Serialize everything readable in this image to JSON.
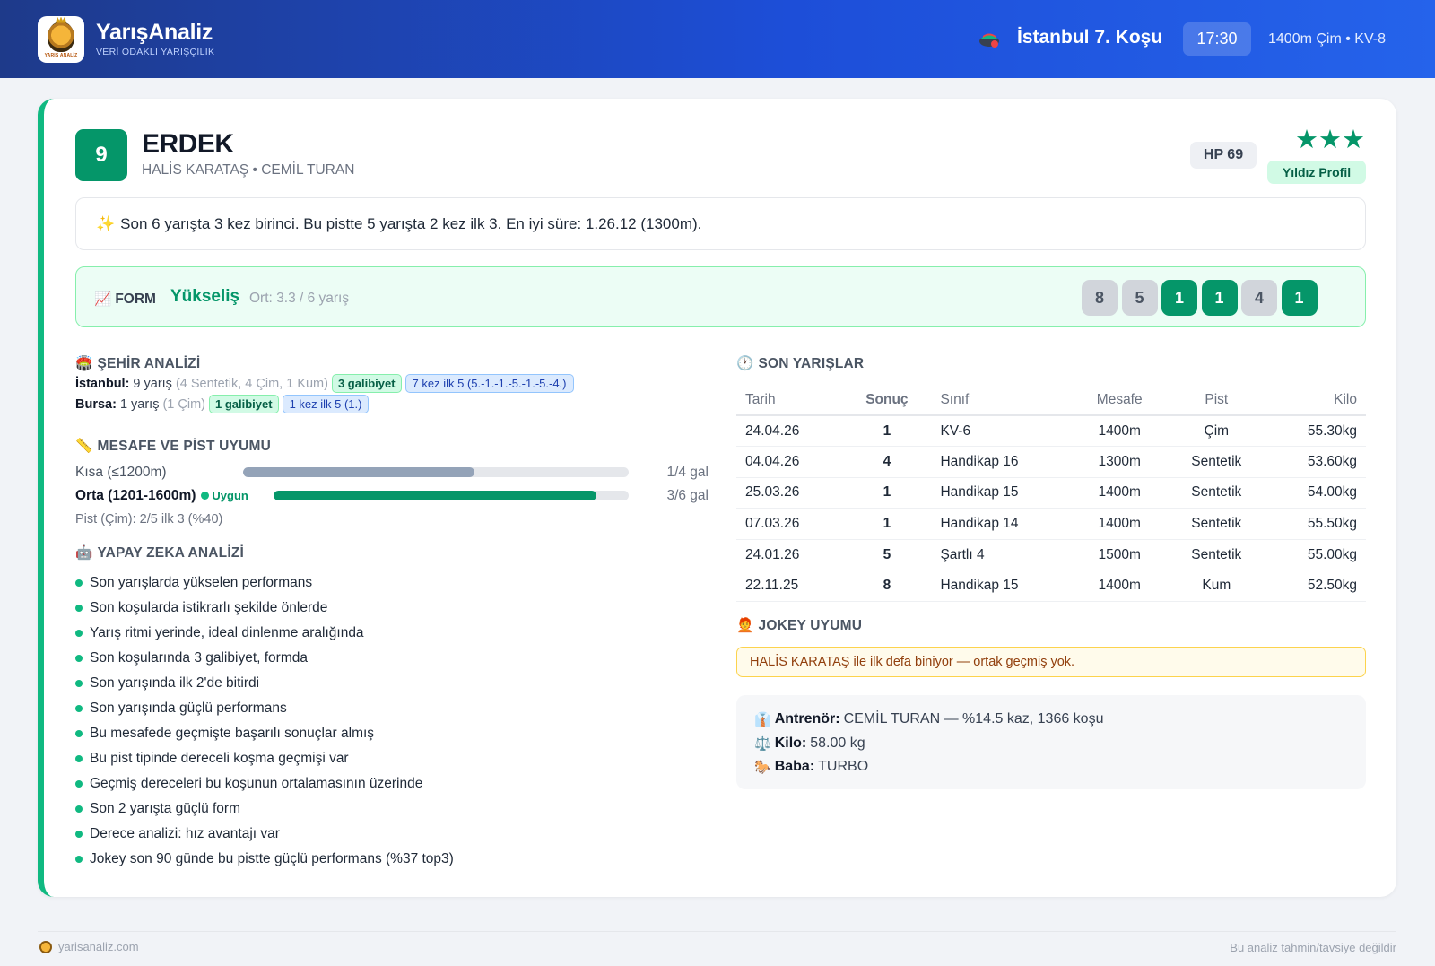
{
  "header": {
    "brand": "YarışAnaliz",
    "brand_sub": "VERİ ODAKLI YARIŞÇILIK",
    "logo_text": "YARIŞ ANALİZ",
    "race_title": "İstanbul 7. Koşu",
    "race_time": "17:30",
    "race_meta": "1400m Çim • KV-8"
  },
  "horse": {
    "number": "9",
    "name": "ERDEK",
    "connections": "HALİS KARATAŞ • CEMİL TURAN",
    "hp": "HP 69",
    "stars": "★★★",
    "star_count": 3,
    "profile": "Yıldız Profil"
  },
  "summary": "Son 6 yarışta 3 kez birinci. Bu pistte 5 yarışta 2 kez ilk 3. En iyi süre: 1.26.12 (1300m).",
  "form": {
    "label": "FORM",
    "trend": "Yükseliş",
    "avg": "Ort: 3.3 / 6 yarış",
    "results": [
      "8",
      "5",
      "1",
      "1",
      "4",
      "1"
    ]
  },
  "city": {
    "title": "ŞEHİR ANALİZİ",
    "rows": [
      {
        "city": "İstanbul:",
        "races": "9 yarış",
        "detail": "(4 Sentetik, 4 Çim, 1 Kum)",
        "wins": "3 galibiyet",
        "top5": "7 kez ilk 5 (5.-1.-1.-5.-1.-5.-4.)"
      },
      {
        "city": "Bursa:",
        "races": "1 yarış",
        "detail": "(1 Çim)",
        "wins": "1 galibiyet",
        "top5": "1 kez ilk 5 (1.)"
      }
    ]
  },
  "distance": {
    "title": "MESAFE VE PİST UYUMU",
    "rows": [
      {
        "label": "Kısa (≤1200m)",
        "count": "1/4 gal",
        "fill": 0.6,
        "color": "#94a3b8",
        "ok": ""
      },
      {
        "label": "Orta (1201-1600m)",
        "count": "3/6 gal",
        "fill": 0.91,
        "color": "#059669",
        "ok": "Uygun"
      }
    ],
    "pist_note": "Pist (Çim): 2/5 ilk 3 (%40)"
  },
  "ai": {
    "title": "YAPAY ZEKA ANALİZİ",
    "items": [
      "Son yarışlarda yükselen performans",
      "Son koşularda istikrarlı şekilde önlerde",
      "Yarış ritmi yerinde, ideal dinlenme aralığında",
      "Son koşularında 3 galibiyet, formda",
      "Son yarışında ilk 2'de bitirdi",
      "Son yarışında güçlü performans",
      "Bu mesafede geçmişte başarılı sonuçlar almış",
      "Bu pist tipinde dereceli koşma geçmişi var",
      "Geçmiş dereceleri bu koşunun ortalamasının üzerinde",
      "Son 2 yarışta güçlü form",
      "Derece analizi: hız avantajı var",
      "Jokey son 90 günde bu pistte güçlü performans (%37 top3)"
    ]
  },
  "recent": {
    "title": "SON YARIŞLAR",
    "columns": [
      "Tarih",
      "Sonuç",
      "Sınıf",
      "Mesafe",
      "Pist",
      "Kilo"
    ],
    "rows": [
      {
        "date": "24.04.26",
        "result": "1",
        "class": "KV-6",
        "distance": "1400m",
        "track": "Çim",
        "weight": "55.30kg"
      },
      {
        "date": "04.04.26",
        "result": "4",
        "class": "Handikap 16",
        "distance": "1300m",
        "track": "Sentetik",
        "weight": "53.60kg"
      },
      {
        "date": "25.03.26",
        "result": "1",
        "class": "Handikap 15",
        "distance": "1400m",
        "track": "Sentetik",
        "weight": "54.00kg"
      },
      {
        "date": "07.03.26",
        "result": "1",
        "class": "Handikap 14",
        "distance": "1400m",
        "track": "Sentetik",
        "weight": "55.50kg"
      },
      {
        "date": "24.01.26",
        "result": "5",
        "class": "Şartlı 4",
        "distance": "1500m",
        "track": "Sentetik",
        "weight": "55.00kg"
      },
      {
        "date": "22.11.25",
        "result": "8",
        "class": "Handikap 15",
        "distance": "1400m",
        "track": "Kum",
        "weight": "52.50kg"
      }
    ]
  },
  "jockey": {
    "title": "JOKEY UYUMU",
    "note": "HALİS KARATAŞ ile ilk defa biniyor — ortak geçmiş yok."
  },
  "info": {
    "trainer_label": "Antrenör:",
    "trainer_value": "CEMİL TURAN — %14.5 kaz, 1366 koşu",
    "weight_label": "Kilo:",
    "weight_value": "58.00 kg",
    "sire_label": "Baba:",
    "sire_value": "TURBO"
  },
  "footer": {
    "site": "yarisanaliz.com",
    "disclaimer": "Bu analiz tahmin/tavsiye değildir"
  },
  "colors": {
    "accent": "#059669",
    "header": "#1d4ed8",
    "warning_bg": "#fffbeb"
  }
}
